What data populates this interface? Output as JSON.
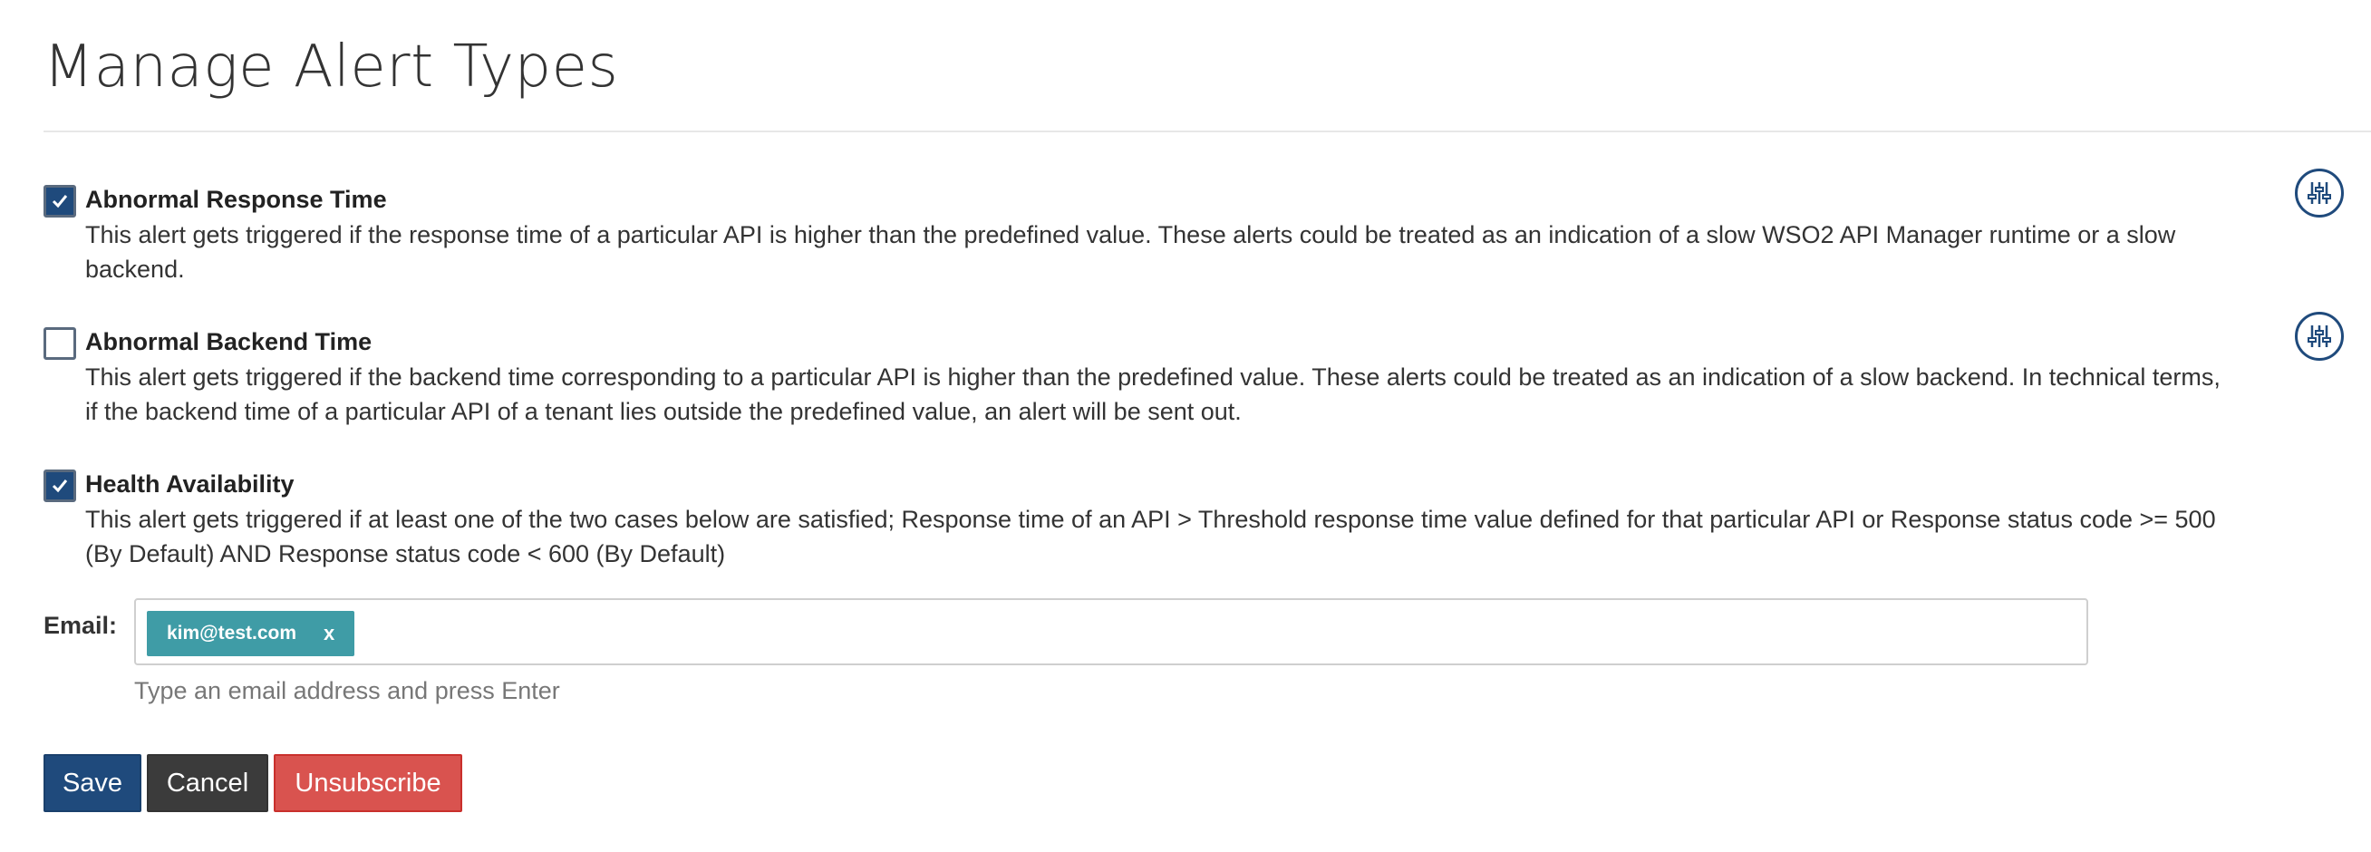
{
  "page": {
    "title": "Manage Alert Types"
  },
  "alerts": [
    {
      "title": "Abnormal Response Time",
      "checked": true,
      "description": "This alert gets triggered if the response time of a particular API is higher than the predefined value. These alerts could be treated as an indication of a slow WSO2 API Manager runtime or a slow backend.",
      "has_settings": true
    },
    {
      "title": "Abnormal Backend Time",
      "checked": false,
      "description": "This alert gets triggered if the backend time corresponding to a particular API is higher than the predefined value. These alerts could be treated as an indication of a slow backend. In technical terms, if the backend time of a particular API of a tenant lies outside the predefined value, an alert will be sent out.",
      "has_settings": true
    },
    {
      "title": "Health Availability",
      "checked": true,
      "description": "This alert gets triggered if at least one of the two cases below are satisfied; Response time of an API > Threshold response time value defined for that particular API or Response status code >= 500 (By Default) AND Response status code < 600 (By Default)",
      "has_settings": false
    }
  ],
  "email": {
    "label": "Email:",
    "tags": [
      {
        "text": "kim@test.com",
        "remove": "x"
      }
    ],
    "input_value": "",
    "hint": "Type an email address and press Enter"
  },
  "buttons": {
    "save": "Save",
    "cancel": "Cancel",
    "unsubscribe": "Unsubscribe"
  },
  "icons": {
    "checkbox_check": "check-icon",
    "settings": "sliders-icon",
    "tag_remove": "x"
  },
  "colors": {
    "primary": "#1f4a7c",
    "tag": "#3f9ca6",
    "cancel": "#3b3b3b",
    "danger": "#d9534f"
  }
}
